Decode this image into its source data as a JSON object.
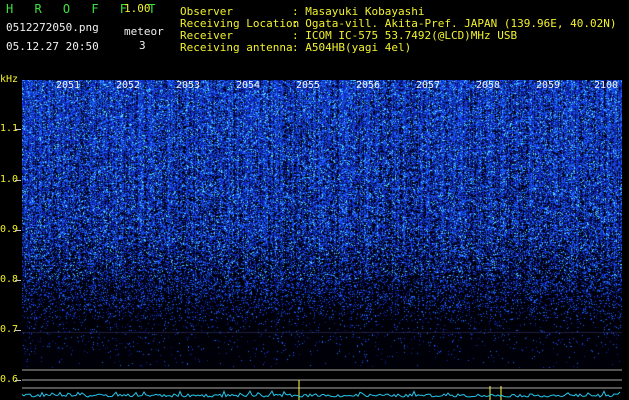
{
  "header": {
    "app_title": "H R O F F T",
    "version": "1.00",
    "filename": "0512272050.png",
    "datetime": "05.12.27 20:50",
    "meteor_label": "meteor",
    "meteor_count": "3",
    "fields": [
      {
        "label": "Observer",
        "value": ": Masayuki Kobayashi"
      },
      {
        "label": "Receiving Location",
        "value": ": Ogata-vill. Akita-Pref. JAPAN (139.96E, 40.02N)"
      },
      {
        "label": "Receiver",
        "value": ": ICOM IC-575 53.7492(@LCD)MHz USB"
      },
      {
        "label": "Receiving antenna",
        "value": ": A504HB(yagi 4el)"
      }
    ]
  },
  "axis": {
    "unit": "kHz",
    "labels": [
      "1.1",
      "1.0",
      "0.9",
      "0.8",
      "0.7",
      "0.6"
    ]
  },
  "time_labels": [
    "2051",
    "2052",
    "2053",
    "2054",
    "2055",
    "2056",
    "2057",
    "2058",
    "2059",
    "2100"
  ],
  "colors": {
    "signal": "#2a55ff",
    "bright": "#40e0ff",
    "background": "#000000",
    "label_green": "#3ce23c",
    "label_yellow": "#f2f22e"
  }
}
